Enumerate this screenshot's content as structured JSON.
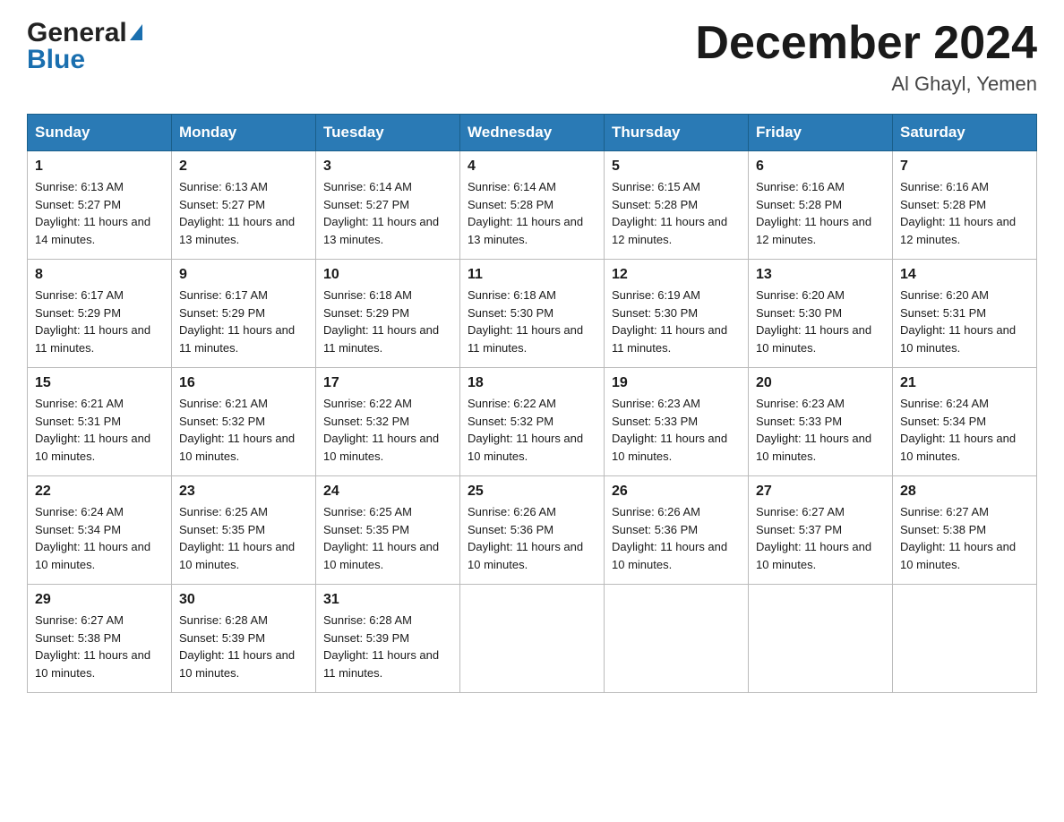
{
  "header": {
    "month_title": "December 2024",
    "location": "Al Ghayl, Yemen"
  },
  "logo": {
    "general": "General",
    "blue": "Blue"
  },
  "days_of_week": [
    "Sunday",
    "Monday",
    "Tuesday",
    "Wednesday",
    "Thursday",
    "Friday",
    "Saturday"
  ],
  "weeks": [
    [
      {
        "day": "1",
        "sunrise": "6:13 AM",
        "sunset": "5:27 PM",
        "daylight": "11 hours and 14 minutes."
      },
      {
        "day": "2",
        "sunrise": "6:13 AM",
        "sunset": "5:27 PM",
        "daylight": "11 hours and 13 minutes."
      },
      {
        "day": "3",
        "sunrise": "6:14 AM",
        "sunset": "5:27 PM",
        "daylight": "11 hours and 13 minutes."
      },
      {
        "day": "4",
        "sunrise": "6:14 AM",
        "sunset": "5:28 PM",
        "daylight": "11 hours and 13 minutes."
      },
      {
        "day": "5",
        "sunrise": "6:15 AM",
        "sunset": "5:28 PM",
        "daylight": "11 hours and 12 minutes."
      },
      {
        "day": "6",
        "sunrise": "6:16 AM",
        "sunset": "5:28 PM",
        "daylight": "11 hours and 12 minutes."
      },
      {
        "day": "7",
        "sunrise": "6:16 AM",
        "sunset": "5:28 PM",
        "daylight": "11 hours and 12 minutes."
      }
    ],
    [
      {
        "day": "8",
        "sunrise": "6:17 AM",
        "sunset": "5:29 PM",
        "daylight": "11 hours and 11 minutes."
      },
      {
        "day": "9",
        "sunrise": "6:17 AM",
        "sunset": "5:29 PM",
        "daylight": "11 hours and 11 minutes."
      },
      {
        "day": "10",
        "sunrise": "6:18 AM",
        "sunset": "5:29 PM",
        "daylight": "11 hours and 11 minutes."
      },
      {
        "day": "11",
        "sunrise": "6:18 AM",
        "sunset": "5:30 PM",
        "daylight": "11 hours and 11 minutes."
      },
      {
        "day": "12",
        "sunrise": "6:19 AM",
        "sunset": "5:30 PM",
        "daylight": "11 hours and 11 minutes."
      },
      {
        "day": "13",
        "sunrise": "6:20 AM",
        "sunset": "5:30 PM",
        "daylight": "11 hours and 10 minutes."
      },
      {
        "day": "14",
        "sunrise": "6:20 AM",
        "sunset": "5:31 PM",
        "daylight": "11 hours and 10 minutes."
      }
    ],
    [
      {
        "day": "15",
        "sunrise": "6:21 AM",
        "sunset": "5:31 PM",
        "daylight": "11 hours and 10 minutes."
      },
      {
        "day": "16",
        "sunrise": "6:21 AM",
        "sunset": "5:32 PM",
        "daylight": "11 hours and 10 minutes."
      },
      {
        "day": "17",
        "sunrise": "6:22 AM",
        "sunset": "5:32 PM",
        "daylight": "11 hours and 10 minutes."
      },
      {
        "day": "18",
        "sunrise": "6:22 AM",
        "sunset": "5:32 PM",
        "daylight": "11 hours and 10 minutes."
      },
      {
        "day": "19",
        "sunrise": "6:23 AM",
        "sunset": "5:33 PM",
        "daylight": "11 hours and 10 minutes."
      },
      {
        "day": "20",
        "sunrise": "6:23 AM",
        "sunset": "5:33 PM",
        "daylight": "11 hours and 10 minutes."
      },
      {
        "day": "21",
        "sunrise": "6:24 AM",
        "sunset": "5:34 PM",
        "daylight": "11 hours and 10 minutes."
      }
    ],
    [
      {
        "day": "22",
        "sunrise": "6:24 AM",
        "sunset": "5:34 PM",
        "daylight": "11 hours and 10 minutes."
      },
      {
        "day": "23",
        "sunrise": "6:25 AM",
        "sunset": "5:35 PM",
        "daylight": "11 hours and 10 minutes."
      },
      {
        "day": "24",
        "sunrise": "6:25 AM",
        "sunset": "5:35 PM",
        "daylight": "11 hours and 10 minutes."
      },
      {
        "day": "25",
        "sunrise": "6:26 AM",
        "sunset": "5:36 PM",
        "daylight": "11 hours and 10 minutes."
      },
      {
        "day": "26",
        "sunrise": "6:26 AM",
        "sunset": "5:36 PM",
        "daylight": "11 hours and 10 minutes."
      },
      {
        "day": "27",
        "sunrise": "6:27 AM",
        "sunset": "5:37 PM",
        "daylight": "11 hours and 10 minutes."
      },
      {
        "day": "28",
        "sunrise": "6:27 AM",
        "sunset": "5:38 PM",
        "daylight": "11 hours and 10 minutes."
      }
    ],
    [
      {
        "day": "29",
        "sunrise": "6:27 AM",
        "sunset": "5:38 PM",
        "daylight": "11 hours and 10 minutes."
      },
      {
        "day": "30",
        "sunrise": "6:28 AM",
        "sunset": "5:39 PM",
        "daylight": "11 hours and 10 minutes."
      },
      {
        "day": "31",
        "sunrise": "6:28 AM",
        "sunset": "5:39 PM",
        "daylight": "11 hours and 11 minutes."
      },
      null,
      null,
      null,
      null
    ]
  ]
}
